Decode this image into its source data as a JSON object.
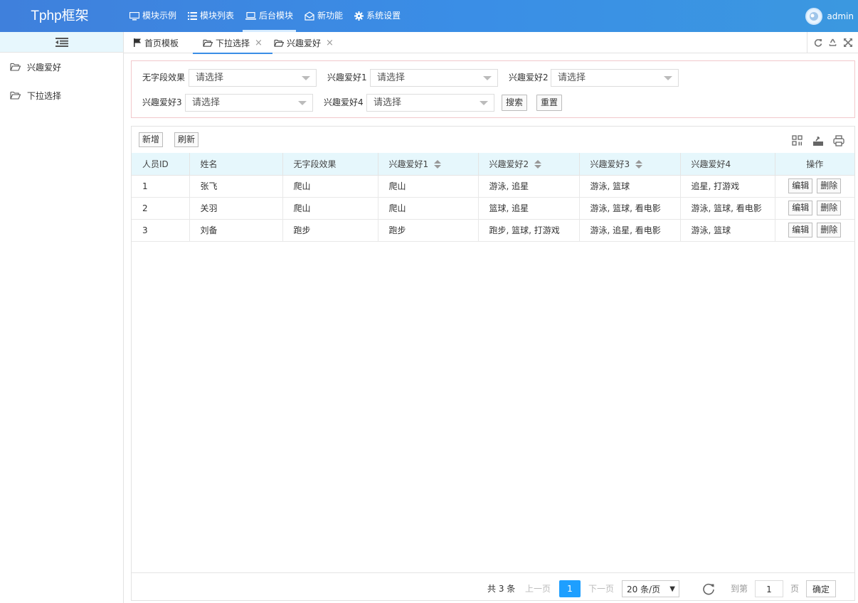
{
  "header": {
    "logo": "Tphp框架",
    "nav": [
      {
        "label": "模块示例",
        "icon": "monitor-icon"
      },
      {
        "label": "模块列表",
        "icon": "list-icon"
      },
      {
        "label": "后台模块",
        "icon": "laptop-icon",
        "active": true
      },
      {
        "label": "新功能",
        "icon": "envelope-open-icon"
      },
      {
        "label": "系统设置",
        "icon": "gear-icon"
      }
    ],
    "user": "admin"
  },
  "sidebar": {
    "items": [
      {
        "label": "兴趣爱好",
        "icon": "folder-open-icon"
      },
      {
        "label": "下拉选择",
        "icon": "folder-open-icon"
      }
    ]
  },
  "tabs": [
    {
      "label": "首页模板",
      "icon": "flag-icon"
    },
    {
      "label": "下拉选择",
      "icon": "folder-open-icon",
      "active": true,
      "close": "×"
    },
    {
      "label": "兴趣爱好",
      "icon": "folder-open-icon",
      "close": "×"
    }
  ],
  "search": {
    "fields": [
      {
        "label": "无字段效果",
        "value": "请选择"
      },
      {
        "label": "兴趣爱好1",
        "value": "请选择"
      },
      {
        "label": "兴趣爱好2",
        "value": "请选择"
      },
      {
        "label": "兴趣爱好3",
        "value": "请选择"
      },
      {
        "label": "兴趣爱好4",
        "value": "请选择"
      }
    ],
    "search_btn": "搜索",
    "reset_btn": "重置"
  },
  "toolbar": {
    "add": "新增",
    "refresh": "刷新"
  },
  "table": {
    "headers": [
      "人员ID",
      "姓名",
      "无字段效果",
      "兴趣爱好1",
      "兴趣爱好2",
      "兴趣爱好3",
      "兴趣爱好4",
      "操作"
    ],
    "rows": [
      [
        "1",
        "张飞",
        "爬山",
        "爬山",
        "游泳, 追星",
        "游泳, 篮球",
        "追星, 打游戏"
      ],
      [
        "2",
        "关羽",
        "爬山",
        "爬山",
        "篮球, 追星",
        "游泳, 篮球, 看电影",
        "游泳, 篮球, 看电影"
      ],
      [
        "3",
        "刘备",
        "跑步",
        "跑步",
        "跑步, 篮球, 打游戏",
        "游泳, 追星, 看电影",
        "游泳, 篮球"
      ]
    ],
    "edit": "编辑",
    "delete": "删除"
  },
  "pager": {
    "total": "共 3 条",
    "prev": "上一页",
    "current": "1",
    "next": "下一页",
    "page_size": "20 条/页",
    "goto": "到第",
    "page_input": "1",
    "page_unit": "页",
    "confirm": "确定"
  }
}
